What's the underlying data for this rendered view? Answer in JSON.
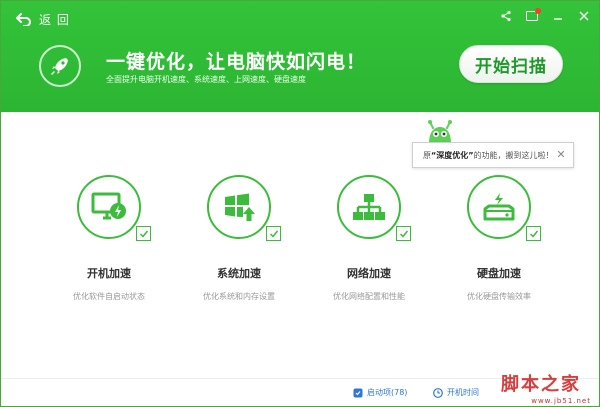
{
  "header": {
    "back_label": "返 回",
    "headline": "一键优化，让电脑快如闪电！",
    "subline": "全面提升电脑开机速度、系统速度、上网速度、硬盘速度",
    "scan_button": "开始扫描"
  },
  "tooltip": {
    "pre": "原",
    "bold": "“深度优化”",
    "post": "的功能，搬到这儿啦！"
  },
  "features": [
    {
      "title": "开机加速",
      "subtitle": "优化软件自启动状态",
      "icon": "monitor-bolt-icon"
    },
    {
      "title": "系统加速",
      "subtitle": "优化系统和内存设置",
      "icon": "windows-up-icon"
    },
    {
      "title": "网络加速",
      "subtitle": "优化网络配置和性能",
      "icon": "network-icon"
    },
    {
      "title": "硬盘加速",
      "subtitle": "优化硬盘传输效率",
      "icon": "hdd-bolt-icon"
    }
  ],
  "footer": {
    "startup_items": "启动项(78)",
    "boot_time": "开机时间"
  },
  "watermark": {
    "brand": "脚本之家",
    "site": "www.jb51.net"
  },
  "colors": {
    "header_green": "#2cb532",
    "accent_green": "#3cbb3c",
    "link_blue": "#2f77d0"
  }
}
